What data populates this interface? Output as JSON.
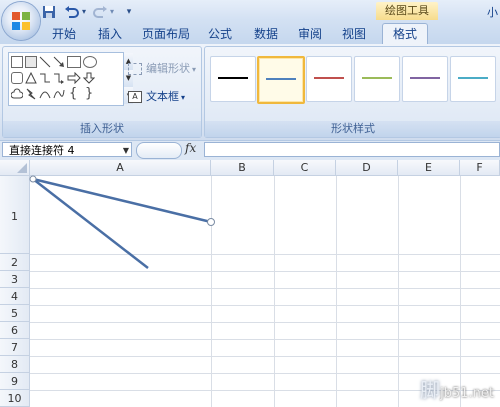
{
  "quick_access": {
    "save_icon": "save-icon",
    "undo_icon": "undo-icon",
    "redo_icon": "redo-icon",
    "customize": "▾"
  },
  "context_tab_group": "绘图工具",
  "title_cut_text": "小",
  "tabs": [
    {
      "label": "开始"
    },
    {
      "label": "插入"
    },
    {
      "label": "页面布局"
    },
    {
      "label": "公式"
    },
    {
      "label": "数据"
    },
    {
      "label": "审阅"
    },
    {
      "label": "视图"
    },
    {
      "label": "格式",
      "active": true
    }
  ],
  "ribbon": {
    "insert_shapes": {
      "label": "插入形状",
      "edit_shape": "编辑形状",
      "text_box": "文本框"
    },
    "shape_styles": {
      "label": "形状样式",
      "swatches": [
        {
          "color": "#000000"
        },
        {
          "color": "#4f81bd",
          "selected": true
        },
        {
          "color": "#c0504d"
        },
        {
          "color": "#9bbb59"
        },
        {
          "color": "#8064a2"
        },
        {
          "color": "#4bacc6"
        }
      ]
    }
  },
  "formula_bar": {
    "name_box": "直接连接符 4",
    "fx": "fx",
    "value": ""
  },
  "sheet": {
    "columns": [
      "A",
      "B",
      "C",
      "D",
      "E",
      "F"
    ],
    "rows": [
      "1",
      "2",
      "3",
      "4",
      "5",
      "6",
      "7",
      "8",
      "9",
      "10"
    ]
  },
  "watermark": {
    "text": "jb51.net",
    "text2": "脚"
  }
}
